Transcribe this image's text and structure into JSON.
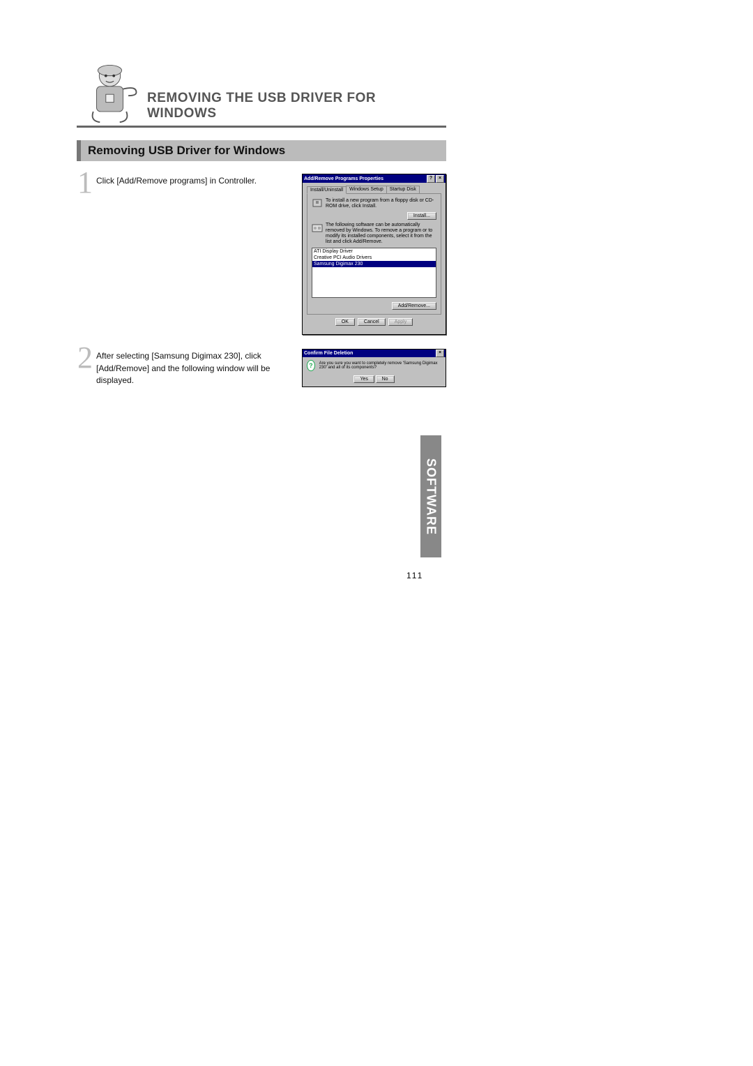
{
  "header": {
    "section_title": "REMOVING THE USB DRIVER FOR WINDOWS",
    "sub_heading": "Removing USB Driver for Windows",
    "side_tab": "SOFTWARE",
    "page_number": "111"
  },
  "steps": [
    {
      "num": "1",
      "text": "Click [Add/Remove programs] in Controller."
    },
    {
      "num": "2",
      "text": "After selecting [Samsung Digimax 230], click [Add/Remove] and the following window will be displayed."
    }
  ],
  "dialog1": {
    "title": "Add/Remove Programs Properties",
    "help_btn": "?",
    "close_btn": "×",
    "tabs": {
      "t1": "Install/Uninstall",
      "t2": "Windows Setup",
      "t3": "Startup Disk"
    },
    "install_text": "To install a new program from a floppy disk or CD-ROM drive, click Install.",
    "install_btn": "Install...",
    "remove_text": "The following software can be automatically removed by Windows. To remove a program or to modify its installed components, select it from the list and click Add/Remove.",
    "list": {
      "i0": "ATI Display Driver",
      "i1": "Creative PCI Audio Drivers",
      "i2": "Samsung Digimax 230"
    },
    "addremove_btn": "Add/Remove...",
    "ok_btn": "OK",
    "cancel_btn": "Cancel",
    "apply_btn": "Apply"
  },
  "dialog2": {
    "title": "Confirm File Deletion",
    "close_btn": "×",
    "message": "Are you sure you want to completely remove 'Samsung Digimax 230' and all of its components?",
    "yes_btn": "Yes",
    "no_btn": "No"
  }
}
